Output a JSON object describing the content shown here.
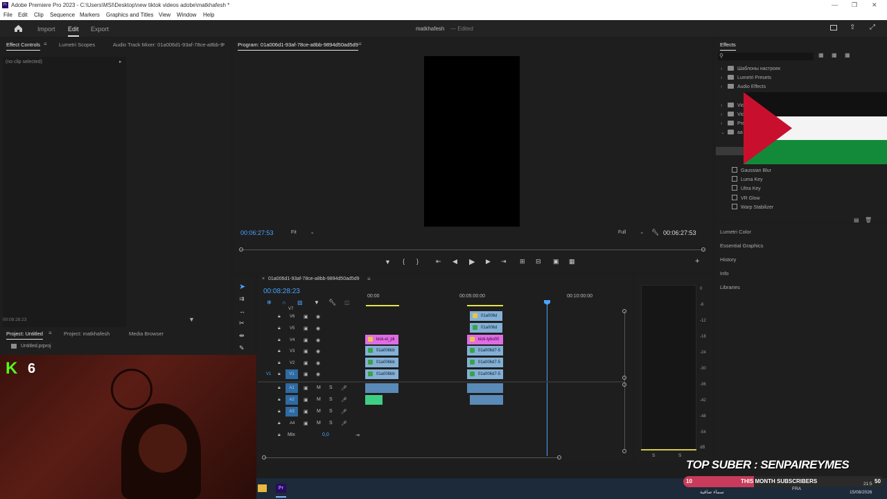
{
  "window": {
    "title": "Adobe Premiere Pro 2023 - C:\\Users\\MSI\\Desktop\\new tiktok videos adobe\\matkhafesh *",
    "logo_text": "Pr"
  },
  "menu": [
    "File",
    "Edit",
    "Clip",
    "Sequence",
    "Markers",
    "Graphics and Titles",
    "View",
    "Window",
    "Help"
  ],
  "header": {
    "nav": [
      "Import",
      "Edit",
      "Export"
    ],
    "active_nav": "Edit",
    "project_name": "matkhafesh",
    "project_status": "Edited"
  },
  "source_panel": {
    "tabs": [
      "Effect Controls",
      "Lumetri Scopes",
      "Audio Track Mixer: 01a006d1-93af-78ce-a8bb-9"
    ],
    "empty_text": "(no clip selected)",
    "timecode": "00:08:28:23"
  },
  "program_monitor": {
    "title": "Program: 01a006d1-93af-78ce-a8bb-9894d50ad5d9",
    "timecode_left": "00:06:27:53",
    "fit": "Fit",
    "quality": "Full",
    "timecode_right": "00:06:27:53"
  },
  "project_panel": {
    "tabs": [
      "Project: Untitled",
      "Project: matkhafesh",
      "Media Browser"
    ],
    "file": "Untitled.prproj"
  },
  "timeline": {
    "sequence_name": "01a006d1-93af-78ce-a8bb-9894d50ad5d9",
    "timecode": "00:08:28:23",
    "ruler_labels": [
      "00:00",
      "00:05:00:00",
      "00:10:00:00"
    ],
    "video_tracks": [
      "V7",
      "V6",
      "V5",
      "V4",
      "V3",
      "V2",
      "V1"
    ],
    "audio_tracks": [
      "A1",
      "A2",
      "A3",
      "A4"
    ],
    "mix_label": "Mix",
    "mix_value": "0,0",
    "v1_source": "V1",
    "clips": {
      "v6_right": "01a006d",
      "v5_right": "01a006d",
      "v4_left": "kick-el_pil",
      "v4_right": "kick-tybo00",
      "v3_left": "01a006bb",
      "v3_right": "01a006d7-5",
      "v2_left": "01a006bb",
      "v2_right": "01a006d7-5",
      "v1_left": "01a006bb",
      "v1_right": "01a006d7-5"
    }
  },
  "audio_meter": {
    "scale": [
      "0",
      "-6",
      "-12",
      "-18",
      "-24",
      "-30",
      "-36",
      "-42",
      "-48",
      "-54",
      "dB"
    ],
    "solo_labels": [
      "S",
      "S"
    ]
  },
  "effects_panel": {
    "title": "Effects",
    "items": [
      {
        "label": "Шаблоны настроек",
        "type": "folder"
      },
      {
        "label": "Lumetri Presets",
        "type": "folder"
      },
      {
        "label": "Audio Effects",
        "type": "folder"
      },
      {
        "label": "Vid",
        "type": "folder"
      },
      {
        "label": "Vid",
        "type": "folder"
      },
      {
        "label": "Pre",
        "type": "folder"
      },
      {
        "label": "aa",
        "type": "folder-open"
      }
    ],
    "effects": [
      "Gaussian Blur",
      "Luma Key",
      "Ultra Key",
      "VR Glow",
      "Warp Stabilizer"
    ],
    "collapsed_panels": [
      "Lumetri Color",
      "Essential Graphics",
      "History",
      "Info",
      "Libraries"
    ]
  },
  "overlay": {
    "counter_letter": "K",
    "counter_value": "6",
    "top_suber": "TOP SUBER : SENPAIREYMES",
    "subs_label": "THIS MONTH SUBSCRIBERS",
    "subs_left": "10",
    "subs_right": "50"
  },
  "taskbar": {
    "lang": "FRA",
    "time": "21:5",
    "date": "15/08/2026",
    "weather": "سماء صافية",
    "pr_icon": "Pr"
  },
  "colors": {
    "accent": "#4aa3ff",
    "pink_clip": "#e06ce4",
    "video_clip": "#84b0d6",
    "audio_clip": "#5a8ab7",
    "green_clip": "#3fcf84"
  }
}
